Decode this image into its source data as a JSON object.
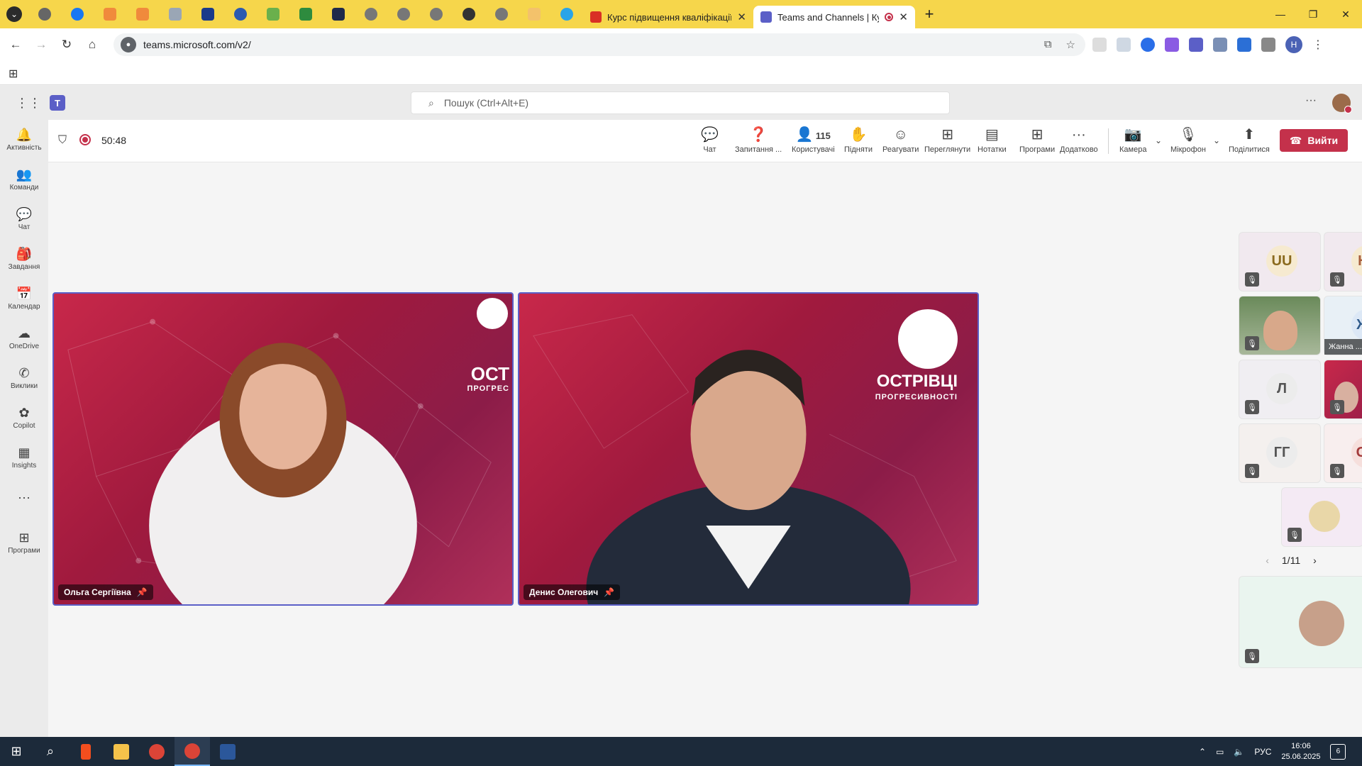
{
  "browser": {
    "tabs": [
      {
        "title": "Курс підвищення кваліфікації",
        "active": false
      },
      {
        "title": "Teams and Channels | Курс",
        "active": true
      }
    ],
    "url": "teams.microsoft.com/v2/",
    "profile_initial": "Н"
  },
  "teams": {
    "search_placeholder": "Пошук (Ctrl+Alt+E)",
    "rail": [
      {
        "label": "Активність",
        "icon": "bell-icon"
      },
      {
        "label": "Команди",
        "icon": "teams-icon"
      },
      {
        "label": "Чат",
        "icon": "chat-icon"
      },
      {
        "label": "Завдання",
        "icon": "backpack-icon"
      },
      {
        "label": "Календар",
        "icon": "calendar-icon"
      },
      {
        "label": "OneDrive",
        "icon": "cloud-icon"
      },
      {
        "label": "Виклики",
        "icon": "phone-icon"
      },
      {
        "label": "Copilot",
        "icon": "copilot-icon"
      },
      {
        "label": "Insights",
        "icon": "insights-icon"
      },
      {
        "label": "...",
        "icon": "more-icon"
      },
      {
        "label": "Програми",
        "icon": "add-apps-icon"
      }
    ]
  },
  "meeting": {
    "timer": "50:48",
    "controls": {
      "chat": "Чат",
      "qa": "Запитання ...",
      "people": "Користувачі",
      "people_count": "115",
      "raise": "Підняти",
      "react": "Реагувати",
      "view": "Переглянути",
      "notes": "Нотатки",
      "apps": "Програми",
      "more": "Додатково",
      "camera": "Камера",
      "mic": "Мікрофон",
      "share": "Поділитися",
      "leave": "Вийти"
    },
    "stage": [
      {
        "name": "Ольга Сергіївна",
        "brand": "ОСТ",
        "brand_sub": "ПРОГРЕС"
      },
      {
        "name": "Денис Олегович",
        "brand": "ОСТРІВЦІ",
        "brand_sub": "ПРОГРЕСИВНОСТІ"
      }
    ],
    "gallery": [
      {
        "initials": "UU",
        "color": "#f6ead0",
        "text": "#8a6a1e"
      },
      {
        "initials": "НГ",
        "color": "#f6ead0",
        "text": "#a85e3c"
      },
      {
        "initials": "",
        "video": true
      },
      {
        "initials": "ЖГ",
        "color": "#dce8f6",
        "text": "#2f5a8a",
        "label": "Жанна ..."
      },
      {
        "initials": "Л",
        "color": "#ececec",
        "text": "#555"
      },
      {
        "initials": "",
        "video": true
      },
      {
        "initials": "ГГ",
        "color": "#ececec",
        "text": "#555"
      },
      {
        "initials": "СМ",
        "color": "#f6dfdc",
        "text": "#a33a3a"
      },
      {
        "initials": "",
        "photo": true
      }
    ],
    "pager": "1/11"
  },
  "taskbar": {
    "lang": "РУС",
    "time": "16:06",
    "date": "25.06.2025",
    "notifications": "6"
  }
}
